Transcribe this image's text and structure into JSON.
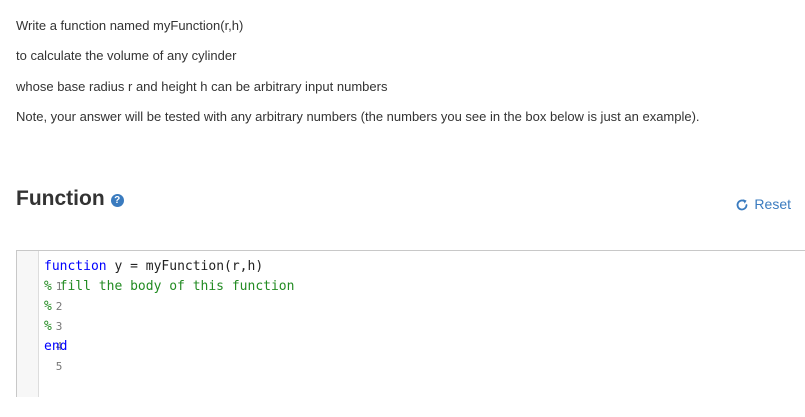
{
  "instructions": [
    "Write a function named myFunction(r,h)",
    "to calculate the volume of any cylinder",
    "whose base radius r and height h can be arbitrary input numbers",
    "Note, your answer will be tested with any arbitrary numbers (the numbers you see in the box below is just an example)."
  ],
  "function_section": {
    "title": "Function",
    "help_icon": "question-circle-icon",
    "help_symbol": "?",
    "reset_label": "Reset",
    "reset_icon": "refresh-icon"
  },
  "editor": {
    "lines": [
      {
        "number": "1",
        "keyword": "function",
        "text": " y = myFunction(r,h)"
      },
      {
        "number": "2",
        "comment": "% fill the body of this function"
      },
      {
        "number": "3",
        "comment": "%"
      },
      {
        "number": "4",
        "comment": "%"
      },
      {
        "number": "5",
        "keyword": "end"
      }
    ]
  },
  "colors": {
    "accent": "#3a7bbf",
    "keyword": "#0000ff",
    "comment": "#228b22"
  }
}
